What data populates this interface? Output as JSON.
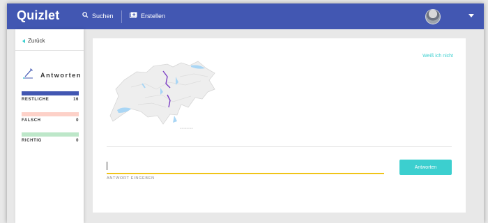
{
  "header": {
    "logo": "Quizlet",
    "search_label": "Suchen",
    "create_label": "Erstellen"
  },
  "sidebar": {
    "back_label": "Zurück",
    "mode_label": "Antworten",
    "progress": [
      {
        "label": "RESTLICHE",
        "count": "16",
        "color": "#4257b2",
        "fill": 1.0
      },
      {
        "label": "FALSCH",
        "count": "0",
        "color": "#fdd1c8",
        "fill": 1.0
      },
      {
        "label": "RICHTIG",
        "count": "0",
        "color": "#bde7c9",
        "fill": 1.0
      }
    ]
  },
  "card": {
    "dont_know_label": "Weiß ich nicht",
    "answer_value": "",
    "answer_hint": "ANTWORT EINGEBEN",
    "answer_button": "Antworten"
  },
  "colors": {
    "brand": "#4257b2",
    "accent": "#3ccfcf",
    "input_underline": "#f0c419"
  }
}
